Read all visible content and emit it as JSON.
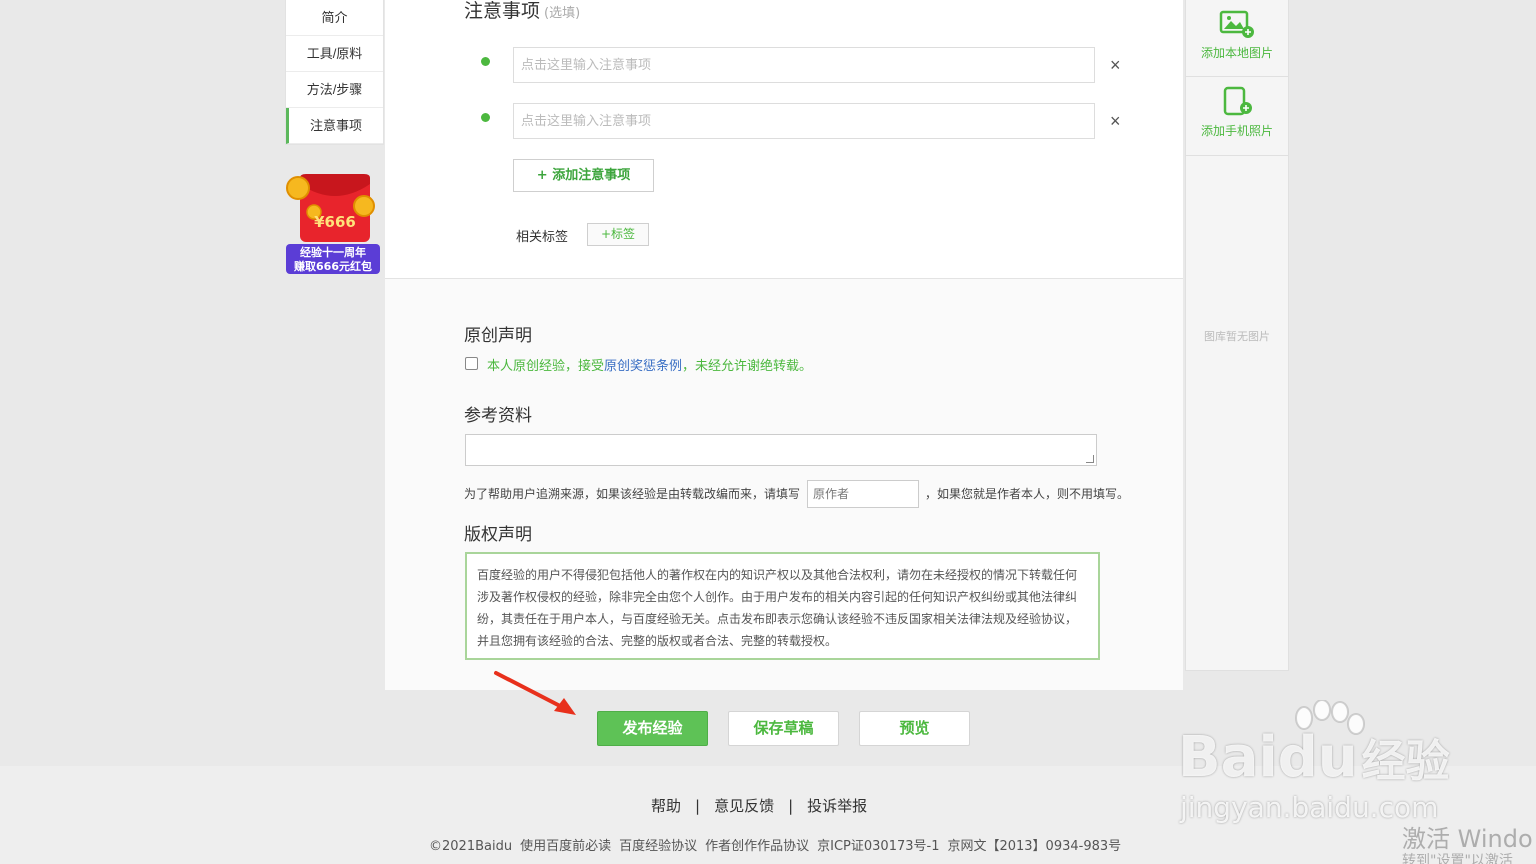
{
  "leftnav": {
    "items": [
      {
        "label": "简介"
      },
      {
        "label": "工具/原料"
      },
      {
        "label": "方法/步骤"
      },
      {
        "label": "注意事项"
      }
    ],
    "promo": {
      "amount": "¥666",
      "line1": "经验十一周年",
      "line2": "赚取666元红包"
    }
  },
  "notes": {
    "title": "注意事项",
    "optional": "(选填)",
    "placeholder": "点击这里输入注意事项",
    "remove_icon": "×",
    "add_label": "+ 添加注意事项",
    "tags_label": "相关标签",
    "add_tag_label": "+标签"
  },
  "original": {
    "title": "原创声明",
    "text_a": "本人原创经验，接受",
    "link": "原创奖惩条例",
    "text_b": "，未经允许谢绝转载。"
  },
  "reference": {
    "title": "参考资料",
    "hint_before": "为了帮助用户追溯来源，如果该经验是由转载改编而来，请填写",
    "author_placeholder": "原作者",
    "hint_after": "，如果您就是作者本人，则不用填写。"
  },
  "copyright": {
    "title": "版权声明",
    "text": "百度经验的用户不得侵犯包括他人的著作权在内的知识产权以及其他合法权利，请勿在未经授权的情况下转载任何涉及著作权侵权的经验，除非完全由您个人创作。由于用户发布的相关内容引起的任何知识产权纠纷或其他法律纠纷，其责任在于用户本人，与百度经验无关。点击发布即表示您确认该经验不违反国家相关法律法规及经验协议，并且您拥有该经验的合法、完整的版权或者合法、完整的转载授权。"
  },
  "rightpanel": {
    "add_local": "添加本地图片",
    "add_phone": "添加手机照片",
    "empty": "图库暂无图片"
  },
  "actions": {
    "publish": "发布经验",
    "draft": "保存草稿",
    "preview": "预览"
  },
  "footer": {
    "links": [
      "帮助",
      "意见反馈",
      "投诉举报"
    ],
    "legal": [
      "©2021Baidu",
      "使用百度前必读",
      "百度经验协议",
      "作者创作作品协议",
      "京ICP证030173号-1",
      "京网文【2013】0934-983号"
    ]
  },
  "watermark": {
    "brand": "Bai",
    "brand2": "du",
    "jingyan": "经验",
    "domain": "jingyan.baidu.com"
  },
  "windows": {
    "line1": "激活 Windo",
    "line2": "转到\"设置\"以激活"
  },
  "colors": {
    "accent": "#4cb83f",
    "publish_bg": "#5ec256",
    "arrow": "#e8301c"
  }
}
